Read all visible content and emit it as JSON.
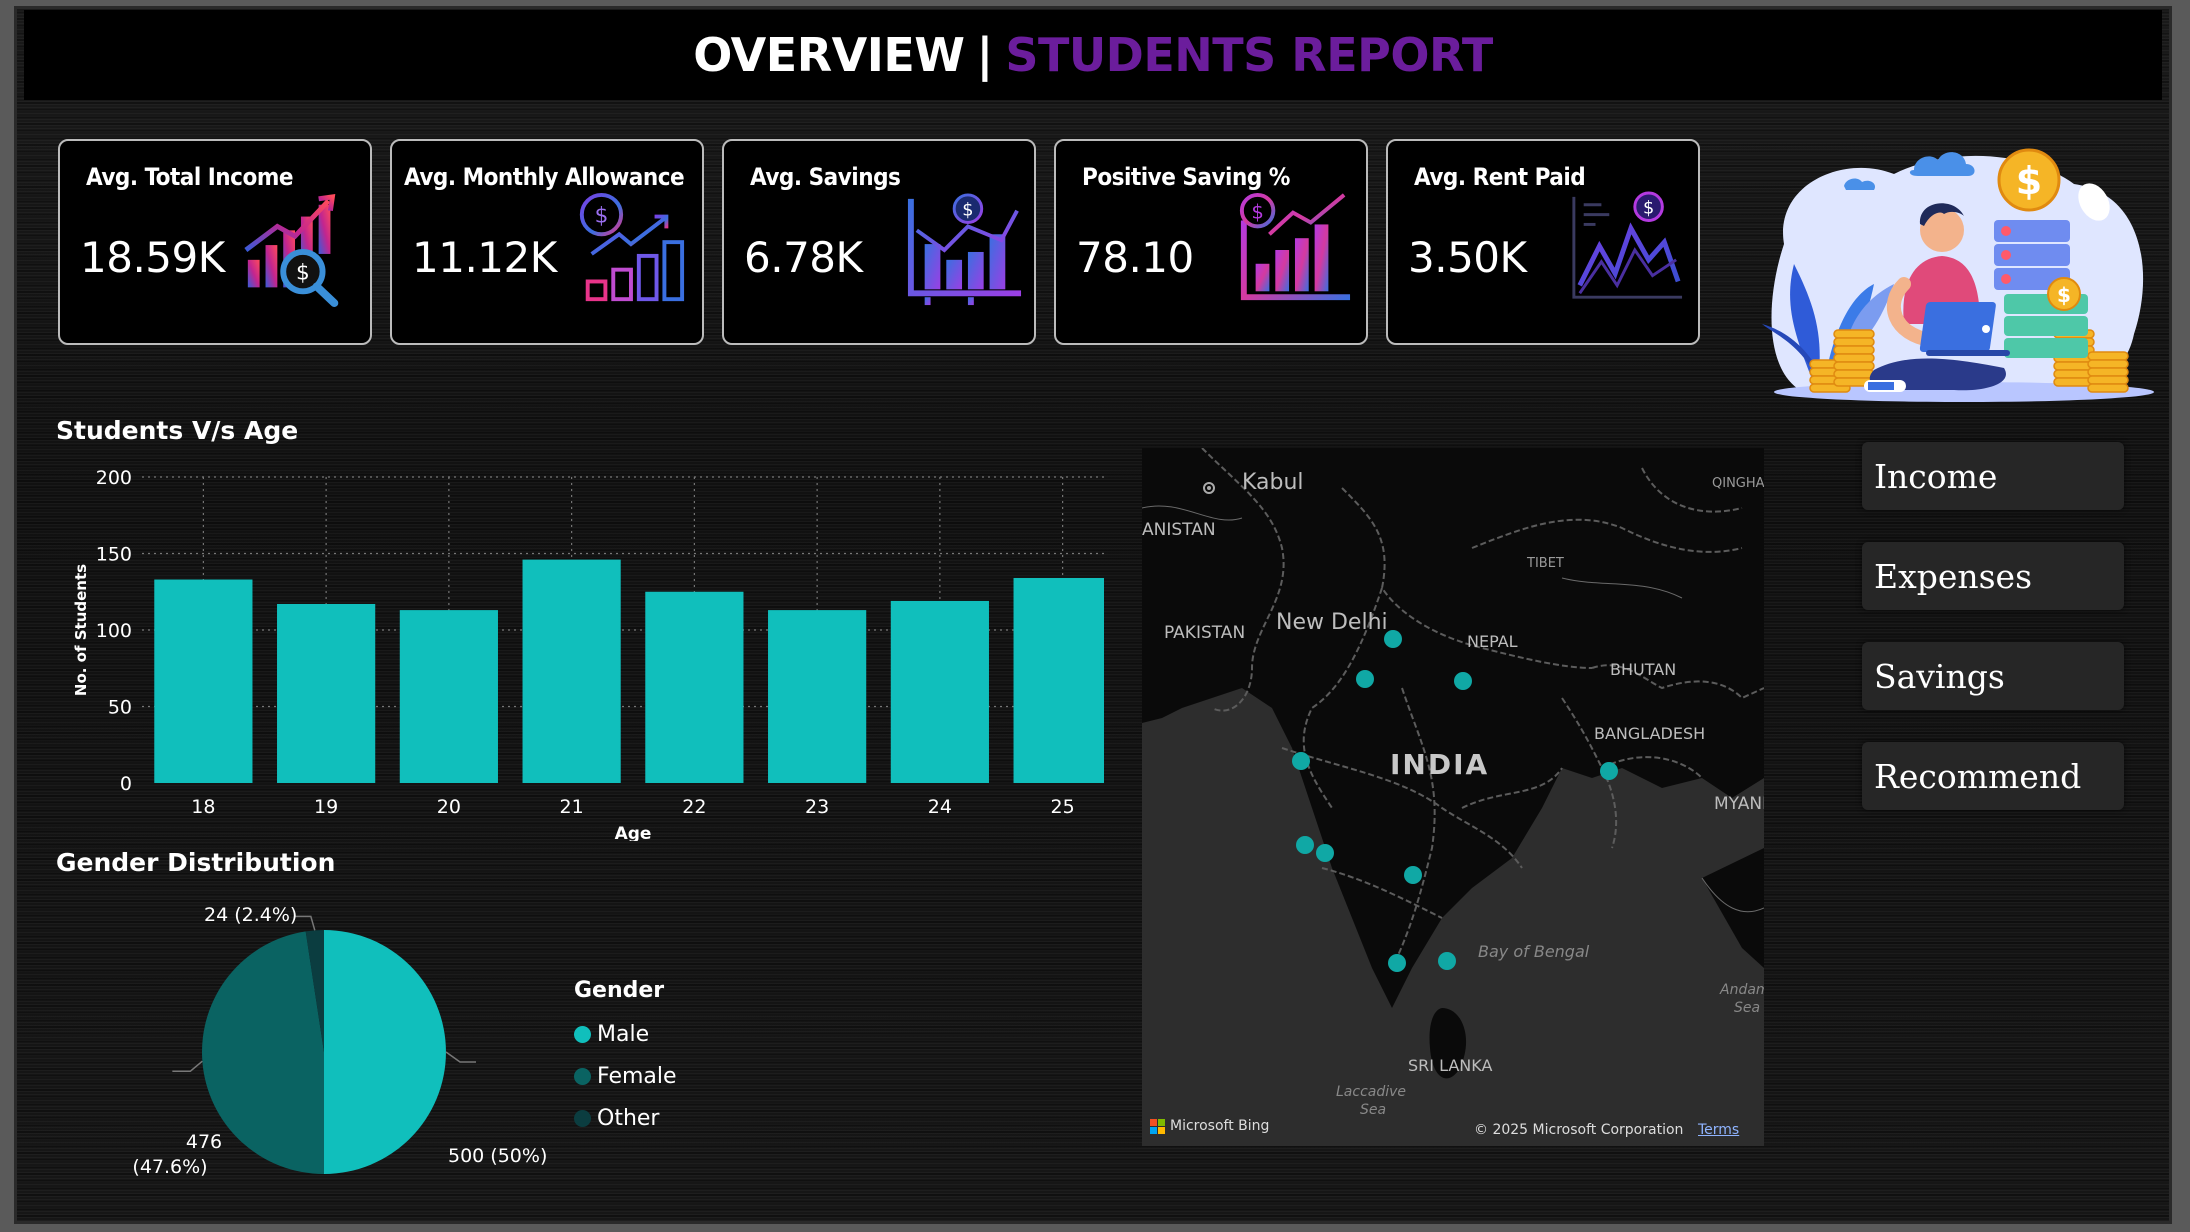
{
  "header": {
    "title_part1": "OVERVIEW",
    "separator": "|",
    "title_part2": "STUDENTS REPORT"
  },
  "kpis": [
    {
      "title": "Avg. Total Income",
      "value": "18.59K",
      "icon": "income-chart-icon"
    },
    {
      "title": "Avg. Monthly Allowance",
      "value": "11.12K",
      "icon": "allowance-growth-icon"
    },
    {
      "title": "Avg. Savings",
      "value": "6.78K",
      "icon": "savings-chart-icon"
    },
    {
      "title": "Positive Saving %",
      "value": "78.10",
      "icon": "positive-saving-icon"
    },
    {
      "title": "Avg. Rent Paid",
      "value": "3.50K",
      "icon": "rent-line-chart-icon"
    }
  ],
  "age_section": {
    "title": "Students V/s Age"
  },
  "gender_section": {
    "title": "Gender Distribution"
  },
  "chart_data": [
    {
      "type": "bar",
      "title": "Students V/s Age",
      "xlabel": "Age",
      "ylabel": "No. of Students",
      "categories": [
        "18",
        "19",
        "20",
        "21",
        "22",
        "23",
        "24",
        "25"
      ],
      "values": [
        133,
        117,
        113,
        146,
        125,
        113,
        119,
        134
      ],
      "ylim": [
        0,
        200
      ],
      "yticks": [
        0,
        50,
        100,
        150,
        200
      ],
      "grid": true,
      "color": "#10bfbc"
    },
    {
      "type": "pie",
      "title": "Gender Distribution",
      "legend_title": "Gender",
      "legend_position": "right",
      "slices": [
        {
          "name": "Male",
          "value": 500,
          "label": "500 (50%)",
          "color": "#10bfbc"
        },
        {
          "name": "Female",
          "value": 476,
          "label_line1": "476",
          "label_line2": "(47.6%)",
          "color": "#0a6362"
        },
        {
          "name": "Other",
          "value": 24,
          "label": "24 (2.4%)",
          "color": "#0b3d40"
        }
      ]
    }
  ],
  "map": {
    "labels": {
      "kabul": "Kabul",
      "afghanistan": "ANISTAN",
      "qinghai": "QINGHAI",
      "tibet": "TIBET",
      "pakistan": "PAKISTAN",
      "new_delhi": "New Delhi",
      "nepal": "NEPAL",
      "bhutan": "BHUTAN",
      "bangladesh": "BANGLADESH",
      "india": "INDIA",
      "myanmar": "MYANI",
      "bay_of_bengal": "Bay of Bengal",
      "andaman": "Andam",
      "andaman2": "Sea",
      "sri_lanka": "SRI LANKA",
      "laccadive": "Laccadive",
      "laccadive2": "Sea"
    },
    "attribution_brand": "Microsoft Bing",
    "copyright": "© 2025 Microsoft Corporation",
    "terms": "Terms",
    "marker_color": "#10a8a5"
  },
  "nav": {
    "income": "Income",
    "expenses": "Expenses",
    "savings": "Savings",
    "recommend": "Recommend"
  }
}
